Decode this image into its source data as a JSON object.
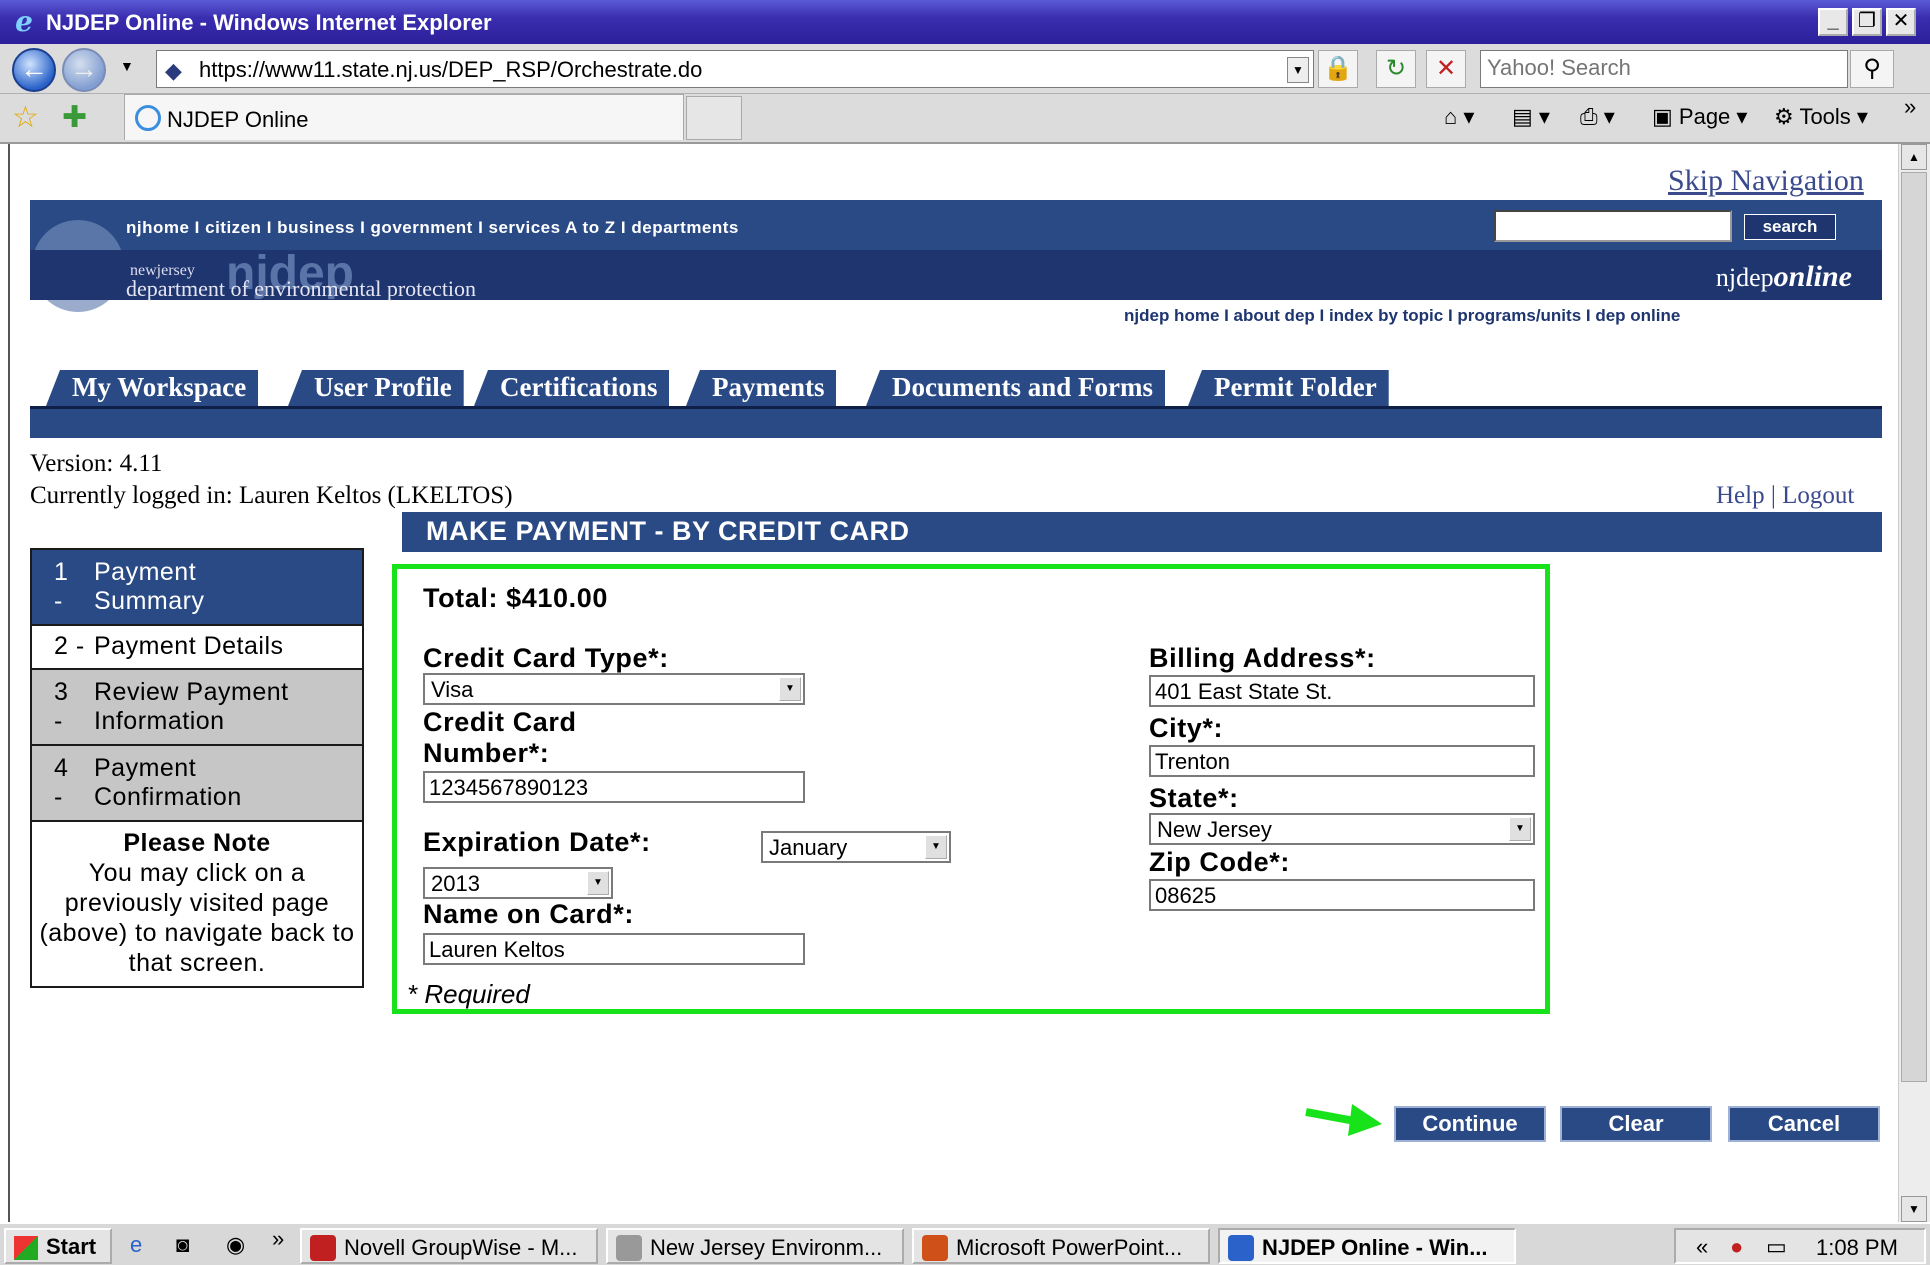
{
  "window": {
    "title": "NJDEP Online - Windows Internet Explorer",
    "url": "https://www11.state.nj.us/DEP_RSP/Orchestrate.do",
    "search_placeholder": "Yahoo! Search",
    "tab_title": "NJDEP Online",
    "commands": {
      "page": "Page",
      "tools": "Tools"
    }
  },
  "header": {
    "skip_nav": "Skip Navigation",
    "top_links": "njhome  I  citizen  I  business  I  government  I  services A to Z  I  departments",
    "search_button": "search",
    "newjersey": "newjersey",
    "njdep_logo": "njdep",
    "department": "department of environmental protection",
    "njdep_prefix": "njdep",
    "online": "online",
    "dep_links": "njdep home  I  about dep  I  index by topic  I  programs/units  I  dep online"
  },
  "tabs": [
    "My Workspace",
    "User Profile",
    "Certifications",
    "Payments",
    "Documents and Forms",
    "Permit Folder"
  ],
  "session": {
    "version": "Version: 4.11",
    "logged_in": "Currently logged in: Lauren Keltos (LKELTOS)",
    "help": "Help",
    "separator": "|",
    "logout": "Logout"
  },
  "page_heading": "MAKE PAYMENT - BY CREDIT CARD",
  "steps": [
    {
      "num": "1\n-",
      "label": "Payment Summary"
    },
    {
      "num": "2 -",
      "label": "Payment Details"
    },
    {
      "num": "3\n-",
      "label": "Review Payment Information"
    },
    {
      "num": "4\n-",
      "label": "Payment Confirmation"
    }
  ],
  "note": {
    "title": "Please Note",
    "body": "You may click on a previously visited page (above) to navigate back to that screen."
  },
  "form": {
    "total": "Total: $410.00",
    "card_type_label": "Credit Card Type*:",
    "card_type": "Visa",
    "card_number_label": "Credit Card Number*:",
    "card_number": "1234567890123",
    "exp_label": "Expiration Date*:",
    "exp_month": "January",
    "exp_year": "2013",
    "name_label": "Name on Card*:",
    "name": "Lauren Keltos",
    "billing_label": "Billing Address*:",
    "billing": "401 East State St.",
    "city_label": "City*:",
    "city": "Trenton",
    "state_label": "State*:",
    "state": "New Jersey",
    "zip_label": "Zip Code*:",
    "zip": "08625",
    "required": "* Required"
  },
  "buttons": {
    "continue": "Continue",
    "clear": "Clear",
    "cancel": "Cancel"
  },
  "taskbar": {
    "start": "Start",
    "tasks": [
      "Novell GroupWise - M...",
      "New Jersey Environm...",
      "Microsoft PowerPoint...",
      "NJDEP Online - Win..."
    ],
    "time": "1:08 PM"
  },
  "colors": {
    "brand_blue": "#2a4a86",
    "highlight_green": "#17e21a"
  }
}
